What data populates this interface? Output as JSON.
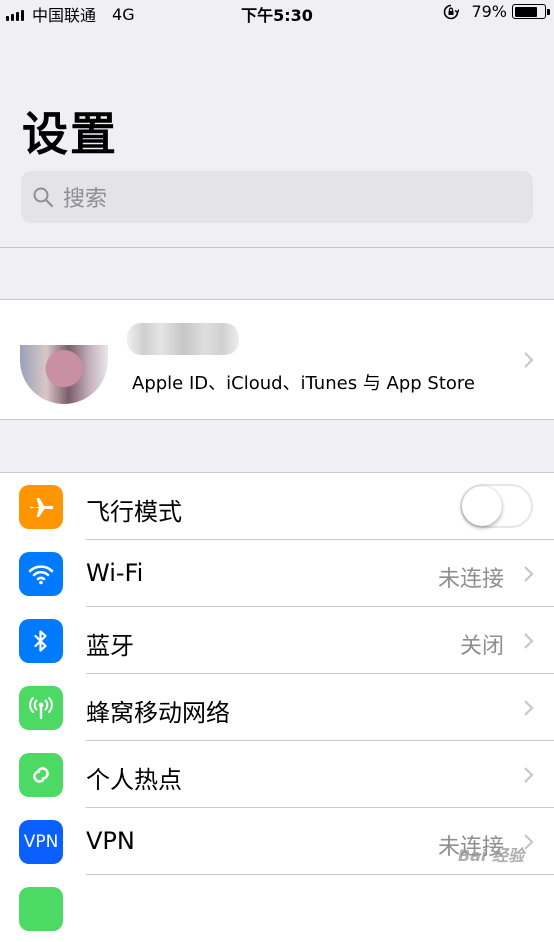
{
  "status_bar": {
    "carrier": "中国联通",
    "network": "4G",
    "time": "下午5:30",
    "battery": "79%",
    "battery_level": 0.79
  },
  "header": {
    "title": "设置",
    "search_placeholder": "搜索"
  },
  "profile": {
    "subtitle": "Apple ID、iCloud、iTunes 与 App Store"
  },
  "rows": [
    {
      "label": "飞行模式",
      "icon": "airplane-icon",
      "color": "#ff9500",
      "toggle": false
    },
    {
      "label": "Wi-Fi",
      "icon": "wifi-icon",
      "color": "#007aff",
      "value": "未连接"
    },
    {
      "label": "蓝牙",
      "icon": "bluetooth-icon",
      "color": "#007aff",
      "value": "关闭"
    },
    {
      "label": "蜂窝移动网络",
      "icon": "cellular-icon",
      "color": "#4cd964",
      "value": ""
    },
    {
      "label": "个人热点",
      "icon": "hotspot-icon",
      "color": "#4cd964",
      "value": ""
    },
    {
      "label": "VPN",
      "icon": "vpn-icon",
      "icon_text": "VPN",
      "color": "#0a60ff",
      "value": "未连接"
    }
  ],
  "watermark": "Bai 经验"
}
